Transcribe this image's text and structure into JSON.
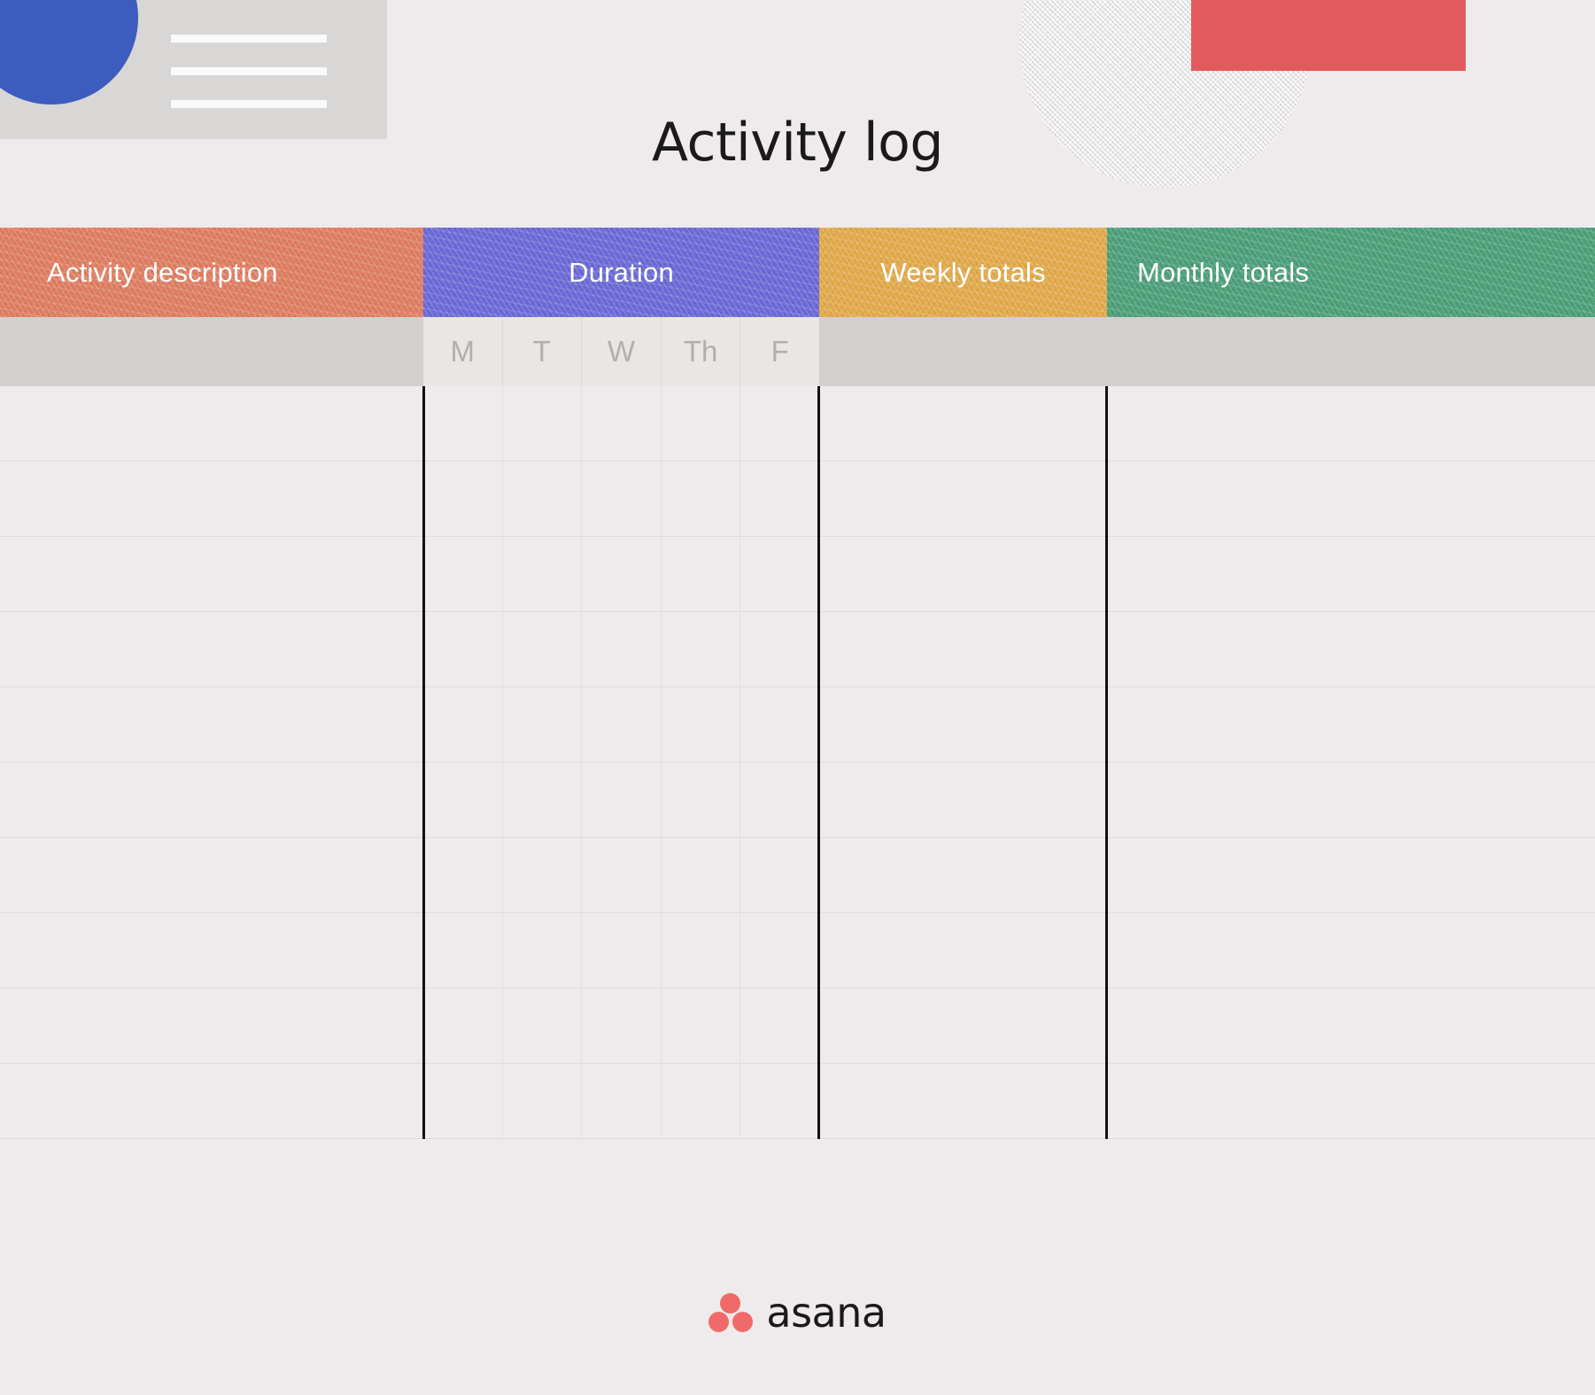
{
  "page": {
    "title": "Activity log",
    "background_color": "#efeaeb"
  },
  "decorations": {
    "blue_circle": {
      "name": "blue-circle",
      "color": "#3d5cbf"
    },
    "gray_card": {
      "name": "gray-card-with-lines",
      "color": "#d9d6d6",
      "line_color": "#fbfafa",
      "line_count": 3
    },
    "texture_circle": {
      "name": "textured-gray-circle",
      "color": "#d6d3d3"
    },
    "red_rect": {
      "name": "red-rectangle",
      "color": "#e15b5e"
    }
  },
  "table": {
    "headers": [
      {
        "label": "Activity description",
        "color": "#df7d61"
      },
      {
        "label": "Duration",
        "color": "#6a69d6"
      },
      {
        "label": "Weekly totals",
        "color": "#e1a949"
      },
      {
        "label": "Monthly totals",
        "color": "#4b9e78"
      }
    ],
    "day_columns": [
      "M",
      "T",
      "W",
      "Th",
      "F"
    ],
    "row_count": 10,
    "rows": [
      {
        "activity": "",
        "days": [
          "",
          "",
          "",
          "",
          ""
        ],
        "weekly": "",
        "monthly": ""
      },
      {
        "activity": "",
        "days": [
          "",
          "",
          "",
          "",
          ""
        ],
        "weekly": "",
        "monthly": ""
      },
      {
        "activity": "",
        "days": [
          "",
          "",
          "",
          "",
          ""
        ],
        "weekly": "",
        "monthly": ""
      },
      {
        "activity": "",
        "days": [
          "",
          "",
          "",
          "",
          ""
        ],
        "weekly": "",
        "monthly": ""
      },
      {
        "activity": "",
        "days": [
          "",
          "",
          "",
          "",
          ""
        ],
        "weekly": "",
        "monthly": ""
      },
      {
        "activity": "",
        "days": [
          "",
          "",
          "",
          "",
          ""
        ],
        "weekly": "",
        "monthly": ""
      },
      {
        "activity": "",
        "days": [
          "",
          "",
          "",
          "",
          ""
        ],
        "weekly": "",
        "monthly": ""
      },
      {
        "activity": "",
        "days": [
          "",
          "",
          "",
          "",
          ""
        ],
        "weekly": "",
        "monthly": ""
      },
      {
        "activity": "",
        "days": [
          "",
          "",
          "",
          "",
          ""
        ],
        "weekly": "",
        "monthly": ""
      },
      {
        "activity": "",
        "days": [
          "",
          "",
          "",
          "",
          ""
        ],
        "weekly": "",
        "monthly": ""
      }
    ]
  },
  "footer": {
    "brand": "asana",
    "dot_color": "#f06a6a"
  }
}
